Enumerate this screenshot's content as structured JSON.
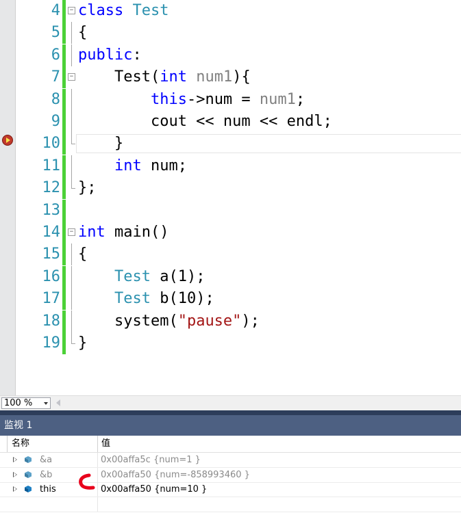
{
  "editor": {
    "lines": [
      {
        "num": "4",
        "tokens": [
          {
            "t": "class",
            "c": "kw"
          },
          {
            "t": " ",
            "c": ""
          },
          {
            "t": "Test",
            "c": "ty"
          }
        ],
        "fold": "box"
      },
      {
        "num": "5",
        "tokens": [
          {
            "t": "{",
            "c": ""
          }
        ],
        "fold": "line"
      },
      {
        "num": "6",
        "tokens": [
          {
            "t": "public",
            "c": "kw"
          },
          {
            "t": ":",
            "c": ""
          }
        ],
        "fold": "line"
      },
      {
        "num": "7",
        "tokens": [
          {
            "t": "    Test(",
            "c": ""
          },
          {
            "t": "int",
            "c": "kw"
          },
          {
            "t": " ",
            "c": ""
          },
          {
            "t": "num1",
            "c": "pm"
          },
          {
            "t": "){",
            "c": ""
          }
        ],
        "fold": "box"
      },
      {
        "num": "8",
        "tokens": [
          {
            "t": "        ",
            "c": ""
          },
          {
            "t": "this",
            "c": "kw"
          },
          {
            "t": "->num = ",
            "c": ""
          },
          {
            "t": "num1",
            "c": "pm"
          },
          {
            "t": ";",
            "c": ""
          }
        ],
        "fold": "line"
      },
      {
        "num": "9",
        "tokens": [
          {
            "t": "        cout << num << endl;",
            "c": ""
          }
        ],
        "fold": "line"
      },
      {
        "num": "10",
        "tokens": [
          {
            "t": "    }",
            "c": ""
          }
        ],
        "fold": "end",
        "current": true
      },
      {
        "num": "11",
        "tokens": [
          {
            "t": "    ",
            "c": ""
          },
          {
            "t": "int",
            "c": "kw"
          },
          {
            "t": " num;",
            "c": ""
          }
        ],
        "fold": "line"
      },
      {
        "num": "12",
        "tokens": [
          {
            "t": "};",
            "c": ""
          }
        ],
        "fold": "end"
      },
      {
        "num": "13",
        "tokens": [],
        "fold": ""
      },
      {
        "num": "14",
        "tokens": [
          {
            "t": "int",
            "c": "kw"
          },
          {
            "t": " main()",
            "c": ""
          }
        ],
        "fold": "box"
      },
      {
        "num": "15",
        "tokens": [
          {
            "t": "{",
            "c": ""
          }
        ],
        "fold": "line"
      },
      {
        "num": "16",
        "tokens": [
          {
            "t": "    ",
            "c": ""
          },
          {
            "t": "Test",
            "c": "ty"
          },
          {
            "t": " a(1);",
            "c": ""
          }
        ],
        "fold": "line"
      },
      {
        "num": "17",
        "tokens": [
          {
            "t": "    ",
            "c": ""
          },
          {
            "t": "Test",
            "c": "ty"
          },
          {
            "t": " b(10);",
            "c": ""
          }
        ],
        "fold": "line"
      },
      {
        "num": "18",
        "tokens": [
          {
            "t": "    system(",
            "c": ""
          },
          {
            "t": "\"pause\"",
            "c": "st"
          },
          {
            "t": ");",
            "c": ""
          }
        ],
        "fold": "line"
      },
      {
        "num": "19",
        "tokens": [
          {
            "t": "}",
            "c": ""
          }
        ],
        "fold": "end"
      }
    ],
    "breakpoint_icon": "current-statement-arrow-icon",
    "colors": {
      "keyword": "#0000ff",
      "type": "#2b91af",
      "param": "#808080",
      "string": "#a31515",
      "linenum": "#2b91af",
      "changebar": "#4cd137"
    }
  },
  "zoom": {
    "value": "100 %"
  },
  "watch": {
    "title": "监视 1",
    "col_name": "名称",
    "col_value": "值",
    "rows": [
      {
        "name": "&a",
        "value": "0x00affa5c {num=1 }",
        "style": "dim",
        "icon": "object-icon"
      },
      {
        "name": "&b",
        "value": "0x00affa50 {num=-858993460 }",
        "style": "dim",
        "icon": "object-icon"
      },
      {
        "name": "this",
        "value": "0x00affa50 {num=10 }",
        "style": "live",
        "icon": "object-icon"
      }
    ]
  }
}
